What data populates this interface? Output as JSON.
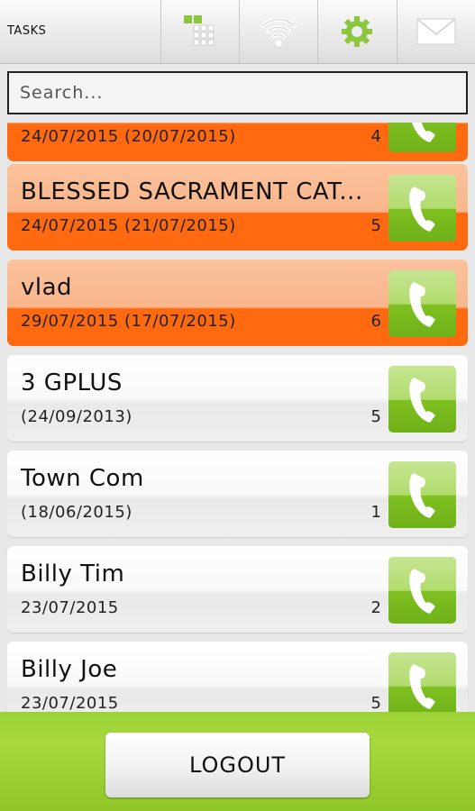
{
  "header": {
    "title": "TASKS",
    "buttons": [
      {
        "icon": "grid-icon"
      },
      {
        "icon": "wifi-icon"
      },
      {
        "icon": "gear-icon"
      },
      {
        "icon": "mail-icon"
      }
    ]
  },
  "search": {
    "placeholder": "Search...",
    "value": ""
  },
  "tasks": [
    {
      "name": "",
      "dates": "24/07/2015 (20/07/2015)",
      "count": "4",
      "highlighted": true
    },
    {
      "name": "BLESSED SACRAMENT CAT...",
      "dates": "24/07/2015 (21/07/2015)",
      "count": "5",
      "highlighted": true
    },
    {
      "name": "vlad",
      "dates": "29/07/2015 (17/07/2015)",
      "count": "6",
      "highlighted": true
    },
    {
      "name": "3 GPLUS",
      "dates": " (24/09/2013)",
      "count": "5",
      "highlighted": false
    },
    {
      "name": "Town Com",
      "dates": " (18/06/2015)",
      "count": "1",
      "highlighted": false
    },
    {
      "name": "Billy Tim",
      "dates": "23/07/2015",
      "count": "2",
      "highlighted": false
    },
    {
      "name": "Billy Joe",
      "dates": "23/07/2015",
      "count": "5",
      "highlighted": false
    }
  ],
  "footer": {
    "logout_label": "LOGOUT"
  },
  "colors": {
    "highlight": "#ff6a10",
    "call_button": "#7fc021",
    "footer": "#9bd236"
  }
}
